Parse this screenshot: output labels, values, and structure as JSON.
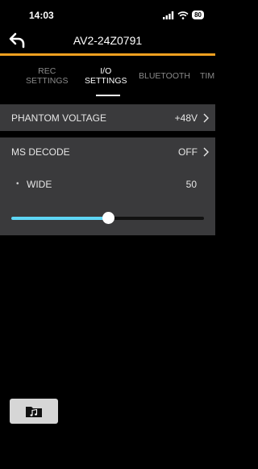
{
  "status": {
    "time": "14:03",
    "battery": "80"
  },
  "header": {
    "title": "AV2-24Z0791"
  },
  "tabs": [
    {
      "line1": "REC",
      "line2": "SETTINGS"
    },
    {
      "line1": "I/O",
      "line2": "SETTINGS"
    },
    {
      "line1": "BLUETOOTH",
      "line2": ""
    },
    {
      "line1": "TIM",
      "line2": ""
    }
  ],
  "settings": {
    "phantom_voltage": {
      "label": "PHANTOM VOLTAGE",
      "value": "+48V"
    },
    "ms_decode": {
      "label": "MS DECODE",
      "value": "OFF"
    },
    "wide": {
      "label": "WIDE",
      "value": "50",
      "bullet": "•",
      "slider_percent": 50
    }
  },
  "colors": {
    "accent": "#f0a020",
    "slider_fill": "#5ed6f5",
    "row_bg": "#3a3a3c"
  },
  "icons": {
    "back": "back-arrow-icon",
    "files": "folder-music-icon"
  }
}
